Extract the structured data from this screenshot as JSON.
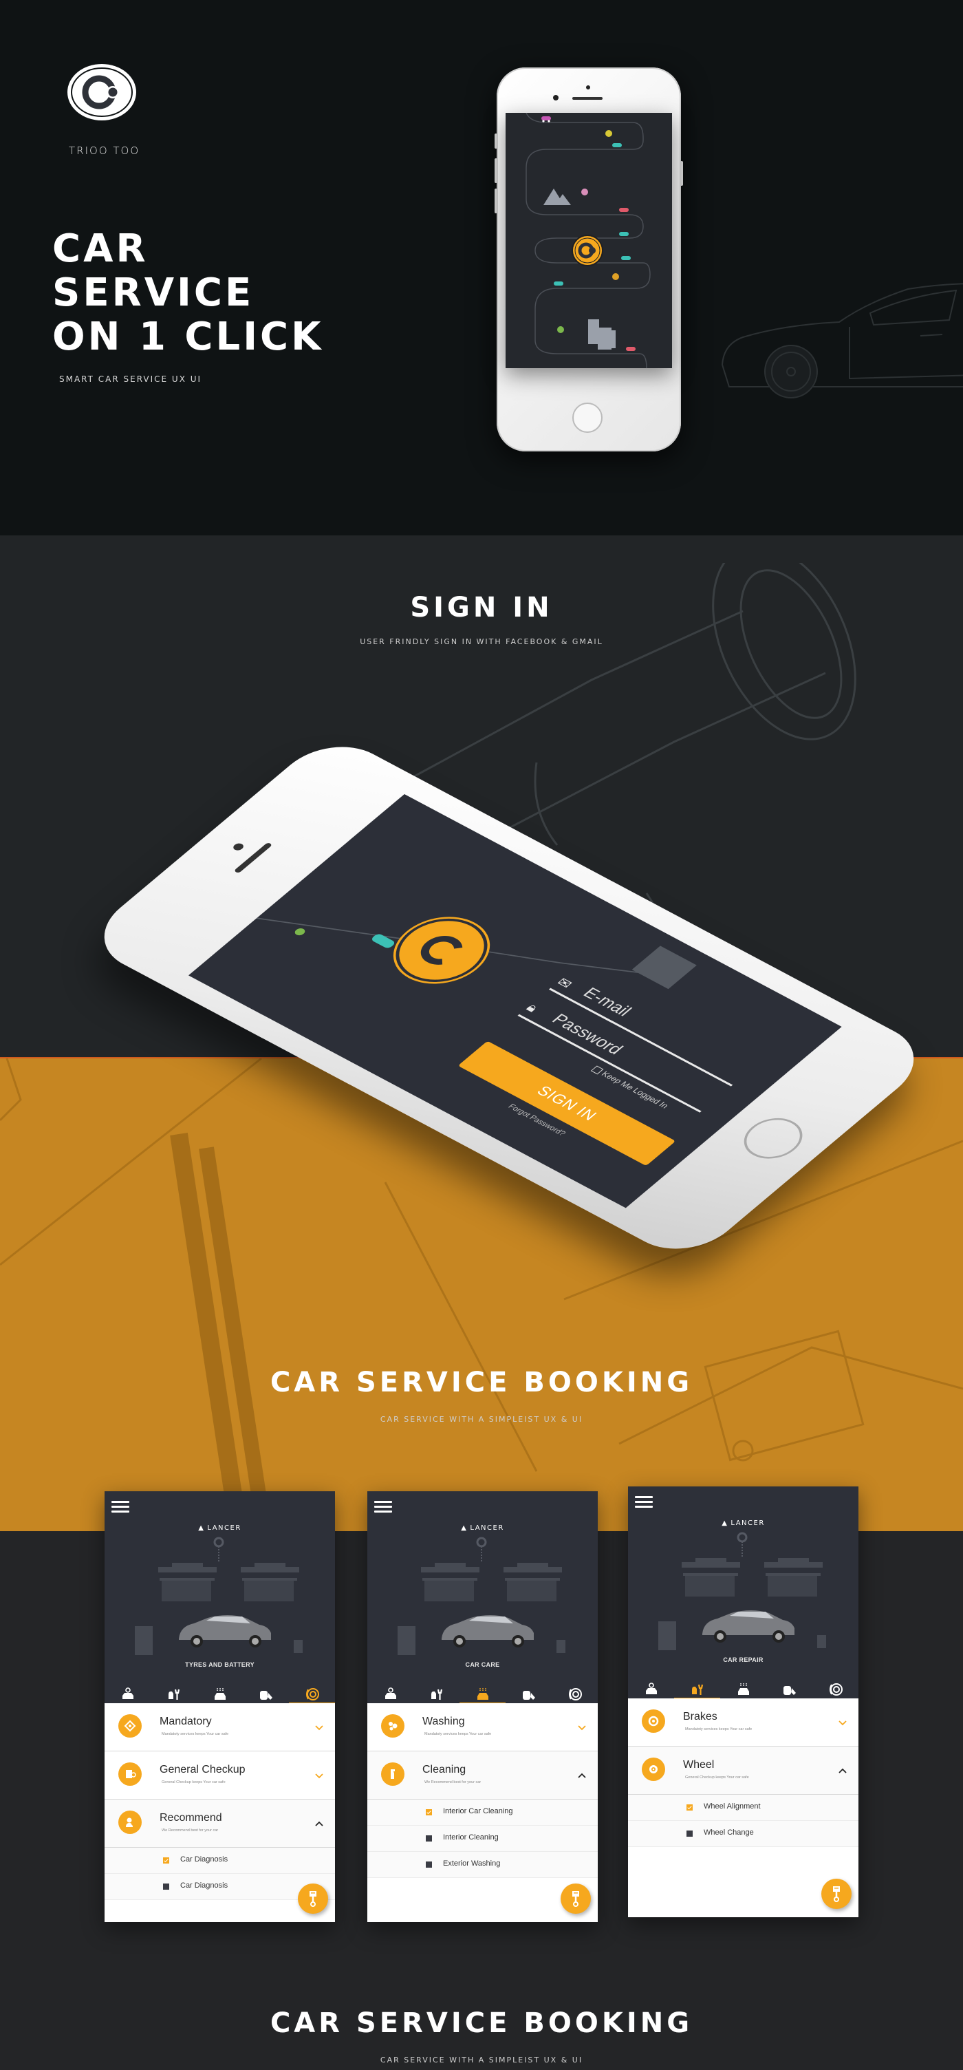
{
  "hero": {
    "brand_name": "TRIOO TOO",
    "title_lines": [
      "CAR",
      "SERVICE",
      "ON 1 CLICK"
    ],
    "subtitle": "SMART CAR SERVICE UX UI"
  },
  "signin_section": {
    "title": "SIGN IN",
    "subtitle": "USER FRINDLY SIGN IN WITH FACEBOOK & GMAIL",
    "form": {
      "email_placeholder": "E-mail",
      "password_placeholder": "Password",
      "keep_logged_in": "Keep Me Logged In",
      "sign_in_button": "SIGN IN",
      "forgot_password": "Forgot Password?"
    }
  },
  "booking_section": {
    "title": "CAR SERVICE BOOKING",
    "subtitle": "CAR SERVICE WITH A SIMPLEIST UX & UI"
  },
  "booking_section_2": {
    "title": "CAR SERVICE BOOKING",
    "subtitle": "CAR SERVICE WITH A SIMPLEIST UX & UI"
  },
  "colors": {
    "accent": "#f6a81e",
    "hero_bg": "#0f1314",
    "section_bg": "#222527",
    "orange_band": "#c68622",
    "app_dark": "#2d3039"
  },
  "tabs": [
    {
      "icon": "car-service-icon"
    },
    {
      "icon": "car-repair-icon"
    },
    {
      "icon": "car-care-icon"
    },
    {
      "icon": "oil-paint-icon"
    },
    {
      "icon": "brake-disc-icon"
    }
  ],
  "screens": [
    {
      "brand": "LANCER",
      "scene_title": "TYRES AND BATTERY",
      "active_tab": 4,
      "sections": [
        {
          "icon": "mandatory-icon",
          "title": "Mandatory",
          "desc": "Mandatoty services keeps Your car safe",
          "open": false,
          "items": []
        },
        {
          "icon": "checkup-icon",
          "title": "General Checkup",
          "desc": "General Checkup keeps Your car safe",
          "open": false,
          "items": []
        },
        {
          "icon": "recommend-icon",
          "title": "Recommend",
          "desc": "We Recommend best for your car",
          "open": true,
          "items": [
            {
              "label": "Car Diagnosis",
              "checked": true
            },
            {
              "label": "Car Diagnosis",
              "checked": false
            }
          ]
        }
      ]
    },
    {
      "brand": "LANCER",
      "scene_title": "CAR CARE",
      "active_tab": 2,
      "sections": [
        {
          "icon": "washing-icon",
          "title": "Washing",
          "desc": "Mandatoty services keeps Your car safe",
          "open": false,
          "items": []
        },
        {
          "icon": "spray-bottle-icon",
          "title": "Cleaning",
          "desc": "We Recommend best for your car",
          "open": true,
          "items": [
            {
              "label": "Interior Car Cleaning",
              "checked": true
            },
            {
              "label": "Interior Cleaning",
              "checked": false
            },
            {
              "label": "Exterior Washing",
              "checked": false
            }
          ]
        }
      ]
    },
    {
      "brand": "LANCER",
      "scene_title": "CAR REPAIR",
      "active_tab": 1,
      "sections": [
        {
          "icon": "brakes-icon",
          "title": "Brakes",
          "desc": "Mandatoty services keeps Your car safe",
          "open": false,
          "items": []
        },
        {
          "icon": "wheel-icon",
          "title": "Wheel",
          "desc": "General Checkup keeps Your car safe",
          "open": true,
          "items": [
            {
              "label": "Wheel Alignment",
              "checked": true
            },
            {
              "label": "Wheel Change",
              "checked": false
            }
          ]
        }
      ]
    }
  ]
}
